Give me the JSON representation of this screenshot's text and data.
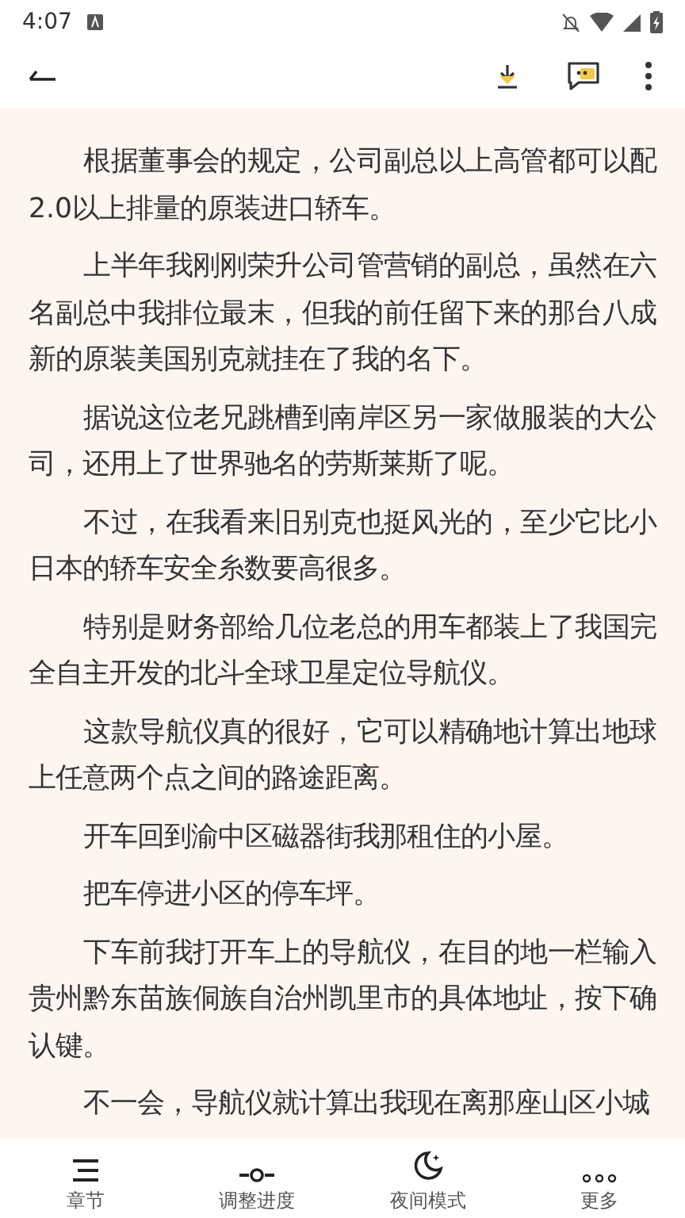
{
  "status_bar": {
    "time": "4:07"
  },
  "chapter": {
    "paragraphs": [
      "根据董事会的规定，公司副总以上高管都可以配2.0以上排量的原装进口轿车。",
      "上半年我刚刚荣升公司管营销的副总，虽然在六名副总中我排位最末，但我的前任留下来的那台八成新的原装美国别克就挂在了我的名下。",
      "据说这位老兄跳槽到南岸区另一家做服装的大公司，还用上了世界驰名的劳斯莱斯了呢。",
      "不过，在我看来旧别克也挺风光的，至少它比小日本的轿车安全糸数要高很多。",
      "特别是财务部给几位老总的用车都装上了我国完全自主开发的北斗全球卫星定位导航仪。",
      "这款导航仪真的很好，它可以精确地计算出地球上任意两个点之间的路途距离。",
      "开车回到渝中区磁器街我那租住的小屋。",
      "把车停进小区的停车坪。",
      "下车前我打开车上的导航仪，在目的地一栏输入贵州黔东苗族侗族自治州凯里市的具体地址，按下确认键。",
      "不一会，导航仪就计算出我现在离那座山区小城"
    ]
  },
  "bottom_nav": [
    {
      "kind": "chapters",
      "label": "章节"
    },
    {
      "kind": "progress",
      "label": "调整进度"
    },
    {
      "kind": "night",
      "label": "夜间模式"
    },
    {
      "kind": "more",
      "label": "更多"
    }
  ]
}
